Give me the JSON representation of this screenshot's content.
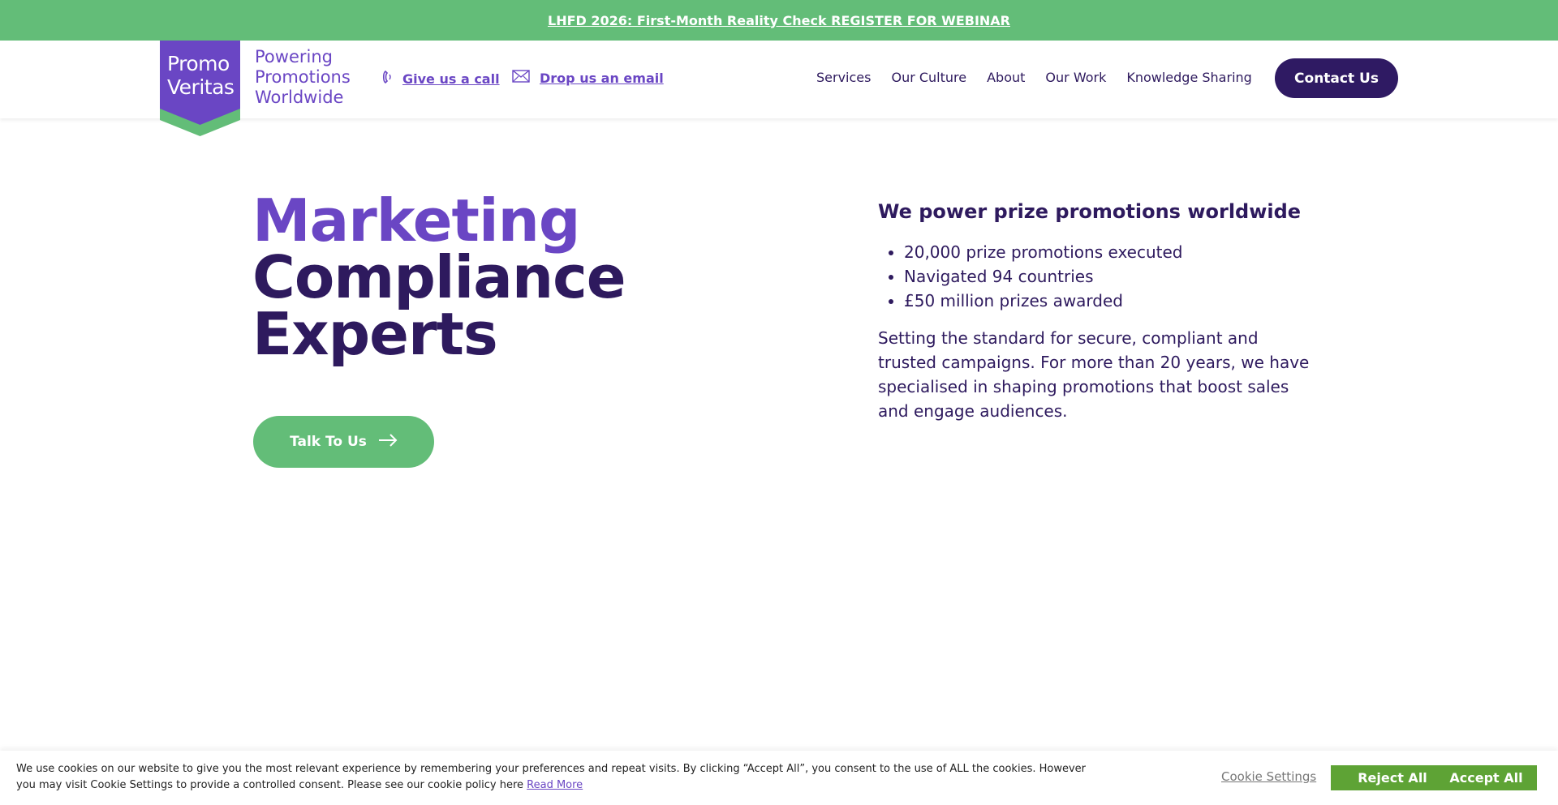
{
  "announcement": {
    "text": "LHFD 2026: First-Month Reality Check REGISTER FOR WEBINAR"
  },
  "logo": {
    "line1": "Promo",
    "line2": "Veritas"
  },
  "tagline": {
    "line1": "Powering",
    "line2": "Promotions",
    "line3": "Worldwide"
  },
  "contact": {
    "call_label": "Give us a call",
    "email_label": "Drop us an email"
  },
  "nav": {
    "items": [
      "Services",
      "Our Culture",
      "About",
      "Our Work",
      "Knowledge Sharing"
    ]
  },
  "contact_button": "Contact Us",
  "hero": {
    "title": [
      "Marketing",
      "Compliance",
      "Experts"
    ],
    "cta": "Talk To Us",
    "heading": "We power prize promotions worldwide",
    "bullets": [
      "20,000 prize promotions executed",
      "Navigated 94 countries",
      "£50 million prizes awarded"
    ],
    "paragraph": "Setting the standard for secure, compliant and trusted campaigns. For more than 20 years, we have specialised in shaping promotions that boost sales and engage audiences."
  },
  "cookie": {
    "text": "We use cookies on our website to give you the most relevant experience by remembering your preferences and repeat visits. By clicking “Accept All”, you consent to the use of ALL the cookies. However you may visit Cookie Settings to provide a controlled consent. Please see our cookie policy here",
    "read_more": "Read More",
    "settings": "Cookie Settings",
    "reject": "Reject All",
    "accept": "Accept All"
  },
  "colors": {
    "green": "#63bd78",
    "purple": "#6a46c4",
    "dark_purple": "#2e1a5e",
    "cookie_green": "#5ea335"
  }
}
